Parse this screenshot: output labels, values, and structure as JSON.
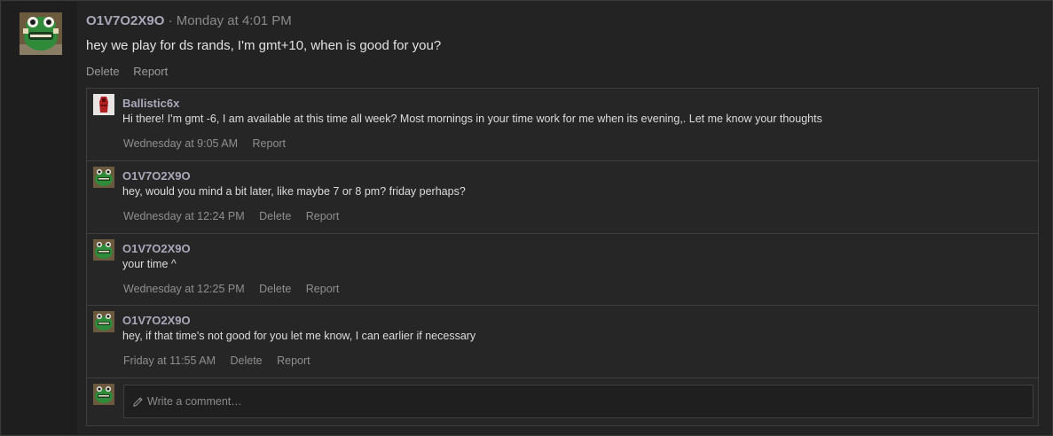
{
  "post": {
    "author": "O1V7O2X9O",
    "separator": "·",
    "time": "Monday at 4:01 PM",
    "text": "hey we play for ds rands, I'm gmt+10, when is good for you?",
    "actions": {
      "delete": "Delete",
      "report": "Report"
    }
  },
  "comments": [
    {
      "author": "Ballistic6x",
      "avatar": "red-character-avatar",
      "text": "Hi there! I'm gmt -6, I am available at this time all week? Most mornings in your time work for me when its evening,. Let me know your thoughts",
      "time": "Wednesday at 9:05 AM",
      "actions": [
        "Report"
      ]
    },
    {
      "author": "O1V7O2X9O",
      "avatar": "frog-avatar",
      "text": "hey, would you mind a bit later, like maybe 7 or 8 pm? friday perhaps?",
      "time": "Wednesday at 12:24 PM",
      "actions": [
        "Delete",
        "Report"
      ]
    },
    {
      "author": "O1V7O2X9O",
      "avatar": "frog-avatar",
      "text": "your time ^",
      "time": "Wednesday at 12:25 PM",
      "actions": [
        "Delete",
        "Report"
      ]
    },
    {
      "author": "O1V7O2X9O",
      "avatar": "frog-avatar",
      "text": "hey, if that time's not good for you let me know, I can earlier if necessary",
      "time": "Friday at 11:55 AM",
      "actions": [
        "Delete",
        "Report"
      ]
    }
  ],
  "compose": {
    "placeholder": "Write a comment…",
    "icon": "pencil-icon"
  },
  "colors": {
    "background": "#232323",
    "author": "#a8a8b8",
    "muted": "#8f8f8f",
    "border": "#3f3f3f"
  }
}
